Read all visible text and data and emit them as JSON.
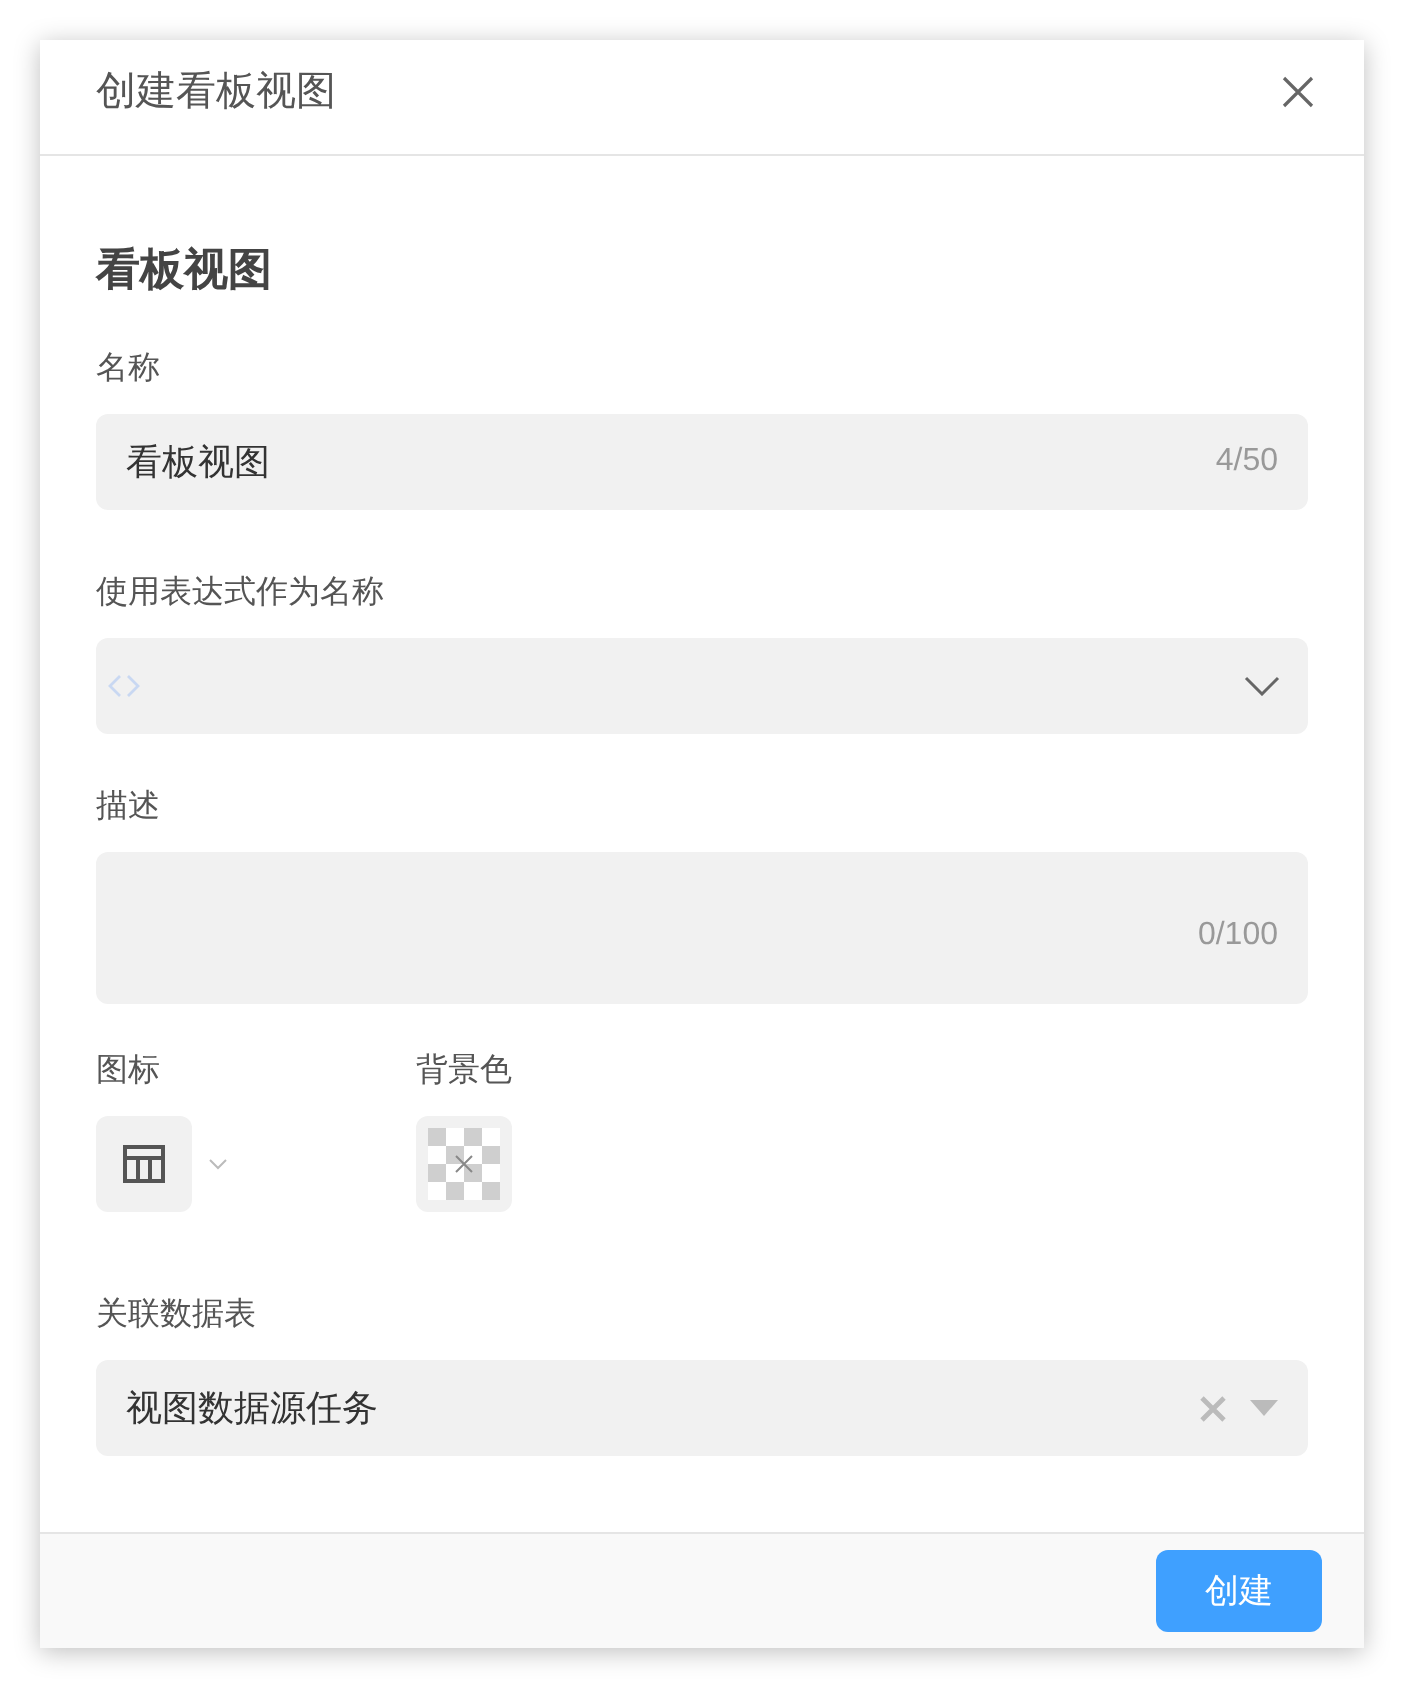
{
  "dialog": {
    "title": "创建看板视图"
  },
  "section_title": "看板视图",
  "name_field": {
    "label": "名称",
    "value": "看板视图",
    "counter": "4/50"
  },
  "expression_field": {
    "label": "使用表达式作为名称"
  },
  "description_field": {
    "label": "描述",
    "counter": "0/100"
  },
  "icon_picker": {
    "label": "图标"
  },
  "background_color_picker": {
    "label": "背景色"
  },
  "linked_table": {
    "label": "关联数据表",
    "value": "视图数据源任务"
  },
  "footer": {
    "create_button": "创建"
  }
}
